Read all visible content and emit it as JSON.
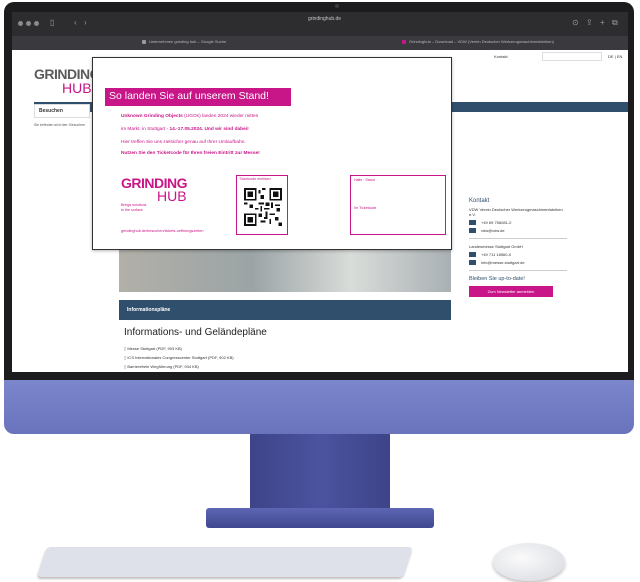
{
  "browser": {
    "url": "grindinghub.de",
    "tab_left": "Unternehmen grinding hub – Google Suche",
    "tab_right": "Grindinghub – Download – VDW (Verein Deutscher Werkzeugmaschinenfabriken)"
  },
  "site": {
    "kontakt_link": "Kontakt",
    "language": "DE | EN",
    "logo_grinding": "GRINDING",
    "logo_hub": "HUB",
    "nav_item": "Besuchen",
    "breadcrumb": "Sie befinden sich hier: Besuchen",
    "section_header": "Informationspläne",
    "info_title": "Informations- und Geländepläne",
    "doc_links": [
      "Messe Stuttgart (PDF, 903 KB)",
      "ICS Internationales Congresscenter Stuttgart (PDF, 902 KB)",
      "Barrierefreie Wegführung (PDF, 934 KB)"
    ]
  },
  "sidebar": {
    "kontakt_heading": "Kontakt",
    "org": "VDW Verein Deutscher Werkzeugmaschinenfabriken e.V.",
    "phone1": "+49 69 756081-0",
    "email1": "vdw@vdw.de",
    "org2": "Landesmesse Stuttgart GmbH",
    "phone2": "+49 711 18560-0",
    "email2": "info@messe-stuttgart.de",
    "newsletter_heading": "Bleiben Sie up-to-date!",
    "newsletter_button": "Zum Newsletter anmelden"
  },
  "popup": {
    "heading": "So landen Sie auf unserem Stand!",
    "line1_bold": "Unknown Grinding Objects",
    "line1_rest": " (UGOs) landen 2024 wieder mitten",
    "line2_start": "im Markt, in Stuttgart - ",
    "line2_bold": "14.-17.05.2024. Und wir sind dabei!",
    "line3": "Hier treffen Sie uns zielsicher genau auf Ihrer Umlaufbahn.",
    "line4": "Nutzen Sie den Ticketcode für Ihren freien Eintritt zur Messe!",
    "logo_grinding": "GRINDING",
    "logo_hub": "HUB",
    "tagline1": "Brings solutions",
    "tagline2": "to the surface",
    "url": "grindinghub.de/besuchen/tickets-oeffnungszeiten",
    "ticket_label": "Ticketcode einlösen",
    "field1_label": "Halle · Stand",
    "field2_label": "Ihr Ticketcode"
  }
}
